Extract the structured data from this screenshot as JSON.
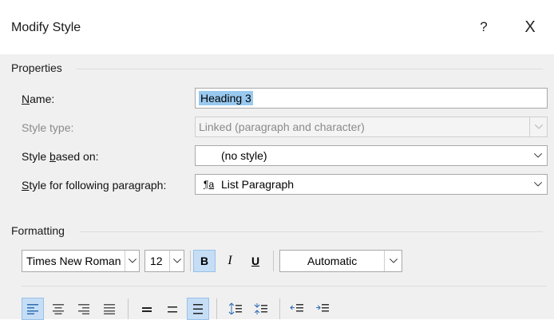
{
  "dialog": {
    "title": "Modify Style",
    "help_glyph": "?",
    "close_glyph": "X"
  },
  "properties": {
    "group_label": "Properties",
    "name_label": "Name:",
    "name_label_underline": "N",
    "name_label_rest": "ame:",
    "name_value": "Heading 3",
    "style_type_label": "Style type:",
    "style_type_value": "Linked (paragraph and character)",
    "based_on_label_pre": "Style ",
    "based_on_label_underline": "b",
    "based_on_label_post": "ased on:",
    "based_on_value": "(no style)",
    "following_label_underline": "S",
    "following_label_rest": "tyle for following paragraph:",
    "following_value": "List Paragraph",
    "following_icon_glyph": "¶a"
  },
  "formatting": {
    "group_label": "Formatting",
    "font_name": "Times New Roman",
    "font_size": "12",
    "bold_label": "B",
    "italic_label": "I",
    "underline_label": "U",
    "color_value": "Automatic",
    "bold_active": true,
    "align_left_active": true,
    "spacing_active": true
  },
  "colors": {
    "accent": "#99c9ef",
    "active_bg": "#c5def5",
    "client_bg": "#f0f0f0"
  }
}
